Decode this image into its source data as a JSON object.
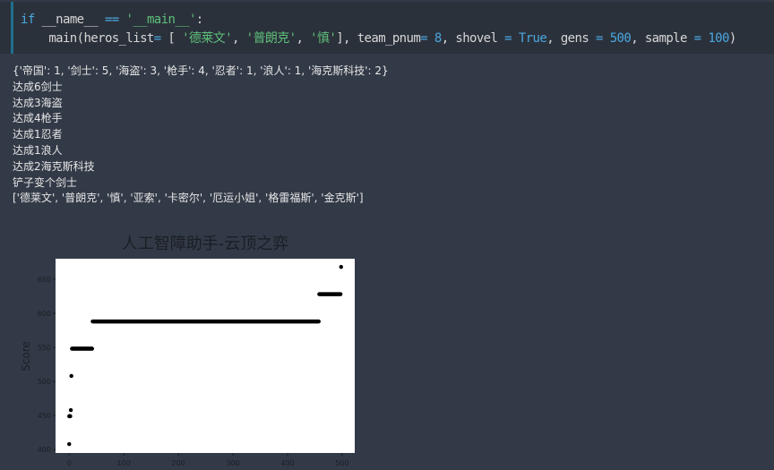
{
  "code_cell": {
    "line1": {
      "kw": "if",
      "a": " __name__ ",
      "op": "==",
      "b": " ",
      "str": "'__main__'",
      "c": ":"
    },
    "line2": {
      "p1": "    main(heros_list",
      "eq1": "=",
      "p2": " [ ",
      "s1": "'德莱文'",
      "p3": ", ",
      "s2": "'普朗克'",
      "p4": ", ",
      "s3": "'慎'",
      "p5": "], team_pnum",
      "eq2": "=",
      "p6": " ",
      "n1": "8",
      "p7": ", shovel ",
      "eq3": "=",
      "p8": " ",
      "t1": "True",
      "p9": ", gens ",
      "eq4": "=",
      "p10": " ",
      "n2": "500",
      "p11": ", sample ",
      "eq5": "=",
      "p12": " ",
      "n3": "100",
      "p13": ")"
    }
  },
  "output": {
    "lines": [
      "{'帝国': 1, '剑士': 5, '海盗': 3, '枪手': 4, '忍者': 1, '浪人': 1, '海克斯科技': 2}",
      "达成6剑士",
      "达成3海盗",
      "达成4枪手",
      "达成1忍者",
      "达成1浪人",
      "达成2海克斯科技",
      "铲子变个剑士",
      "['德莱文', '普朗克', '慎', '亚索', '卡密尔', '厄运小姐', '格雷福斯', '金克斯']"
    ]
  },
  "chart_data": {
    "type": "scatter",
    "title": "人工智障助手-云顶之弈",
    "xlabel": "",
    "ylabel": "Score",
    "xlim": [
      -25,
      523
    ],
    "ylim": [
      395,
      680
    ],
    "xticks": [
      0,
      100,
      200,
      300,
      400,
      500
    ],
    "yticks": [
      400,
      450,
      500,
      550,
      600,
      650
    ],
    "grid": false,
    "points": [
      [
        0,
        408
      ],
      [
        0,
        449
      ],
      [
        1,
        449
      ],
      [
        2,
        449
      ],
      [
        3,
        458
      ],
      [
        4,
        508
      ],
      [
        498,
        668
      ]
    ],
    "runs": [
      {
        "x_start": 5,
        "x_end": 42,
        "y": 548
      },
      {
        "x_start": 43,
        "x_end": 457,
        "y": 588
      },
      {
        "x_start": 458,
        "x_end": 497,
        "y": 628
      }
    ],
    "colors": {
      "marker": "#000000",
      "plot_bg": "#ffffff",
      "text": "#1a1f26"
    }
  }
}
